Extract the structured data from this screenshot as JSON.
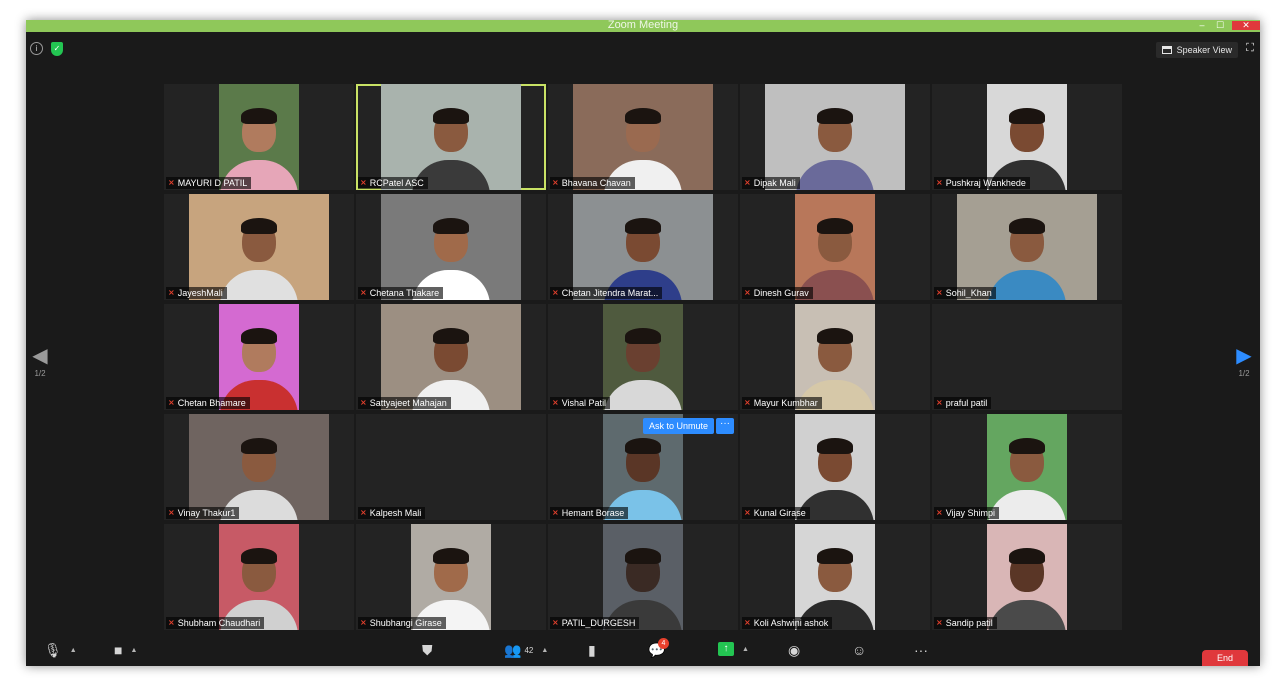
{
  "window": {
    "title": "Zoom Meeting",
    "controls": {
      "minimize": "–",
      "maximize": "☐",
      "close": "✕"
    }
  },
  "topbar": {
    "info_icon": "i",
    "shield_icon": "✓",
    "speaker_view_label": "Speaker View"
  },
  "navigation": {
    "left_arrow": "◀",
    "right_arrow": "▶",
    "page_left": "1/2",
    "page_right": "1/2"
  },
  "ask_to_unmute": {
    "label": "Ask to Unmute",
    "more": "···"
  },
  "participants": [
    {
      "name": "MAYURI D PATIL",
      "active": false,
      "video": true,
      "bg": "#5b7a4a",
      "skin": "#b07b5e",
      "shirt": "#e6a6b8"
    },
    {
      "name": "RCPatel ASC",
      "active": true,
      "video": true,
      "bg": "#a9b3ad",
      "skin": "#8a5a3f",
      "shirt": "#3a3a3a",
      "wide": true
    },
    {
      "name": "Bhavana Chavan",
      "active": false,
      "video": true,
      "bg": "#8a6b5a",
      "skin": "#9a6a50",
      "shirt": "#f0f0f0",
      "wide": true
    },
    {
      "name": "Dipak Mali",
      "active": false,
      "video": true,
      "bg": "#bfbfbf",
      "skin": "#8a5a3f",
      "shirt": "#6a6a9a",
      "wide": true
    },
    {
      "name": "Pushkraj Wankhede",
      "active": false,
      "video": true,
      "bg": "#d8d8d8",
      "skin": "#7a4a32",
      "shirt": "#303030"
    },
    {
      "name": "JayeshMali",
      "active": false,
      "video": true,
      "bg": "#c7a47e",
      "skin": "#8a5a3f",
      "shirt": "#e0e0e0",
      "wide": true
    },
    {
      "name": "Chetana Thakare",
      "active": false,
      "video": true,
      "bg": "#7a7a7a",
      "skin": "#a06a4a",
      "shirt": "#ffffff",
      "wide": true
    },
    {
      "name": "Chetan Jitendra Marat...",
      "active": false,
      "video": true,
      "bg": "#8c9092",
      "skin": "#7a4a32",
      "shirt": "#2e3e8a",
      "wide": true
    },
    {
      "name": "Dinesh Gurav",
      "active": false,
      "video": true,
      "bg": "#b8775a",
      "skin": "#8a5a3f",
      "shirt": "#8a5050"
    },
    {
      "name": "Sohil_Khan",
      "active": false,
      "video": true,
      "bg": "#a59f93",
      "skin": "#8a5a3f",
      "shirt": "#3a8ac2",
      "wide": true
    },
    {
      "name": "Chetan Bhamare",
      "active": false,
      "video": true,
      "bg": "#d46ad1",
      "skin": "#b07b5e",
      "shirt": "#c93030"
    },
    {
      "name": "Sattyajeet Mahajan",
      "active": false,
      "video": true,
      "bg": "#9c8f82",
      "skin": "#7a4a32",
      "shirt": "#f0f0f0",
      "wide": true
    },
    {
      "name": "Vishal Patil",
      "active": false,
      "video": true,
      "bg": "#4f5a3e",
      "skin": "#6a4030",
      "shirt": "#d8d8d8"
    },
    {
      "name": "Mayur Kumbhar",
      "active": false,
      "video": true,
      "bg": "#c8bfb4",
      "skin": "#8a5a3f",
      "shirt": "#d6c8a8"
    },
    {
      "name": "praful patil",
      "active": false,
      "video": false
    },
    {
      "name": "Vinay Thakur1",
      "active": false,
      "video": true,
      "bg": "#6f6460",
      "skin": "#8a5a3f",
      "shirt": "#dcdcdc",
      "wide": true
    },
    {
      "name": "Kalpesh Mali",
      "active": false,
      "video": false
    },
    {
      "name": "Hemant Borase",
      "active": false,
      "video": true,
      "bg": "#5e6a6e",
      "skin": "#5a3626",
      "shirt": "#7ac2e8"
    },
    {
      "name": "Kunal Girase",
      "active": false,
      "video": true,
      "bg": "#d0d0d0",
      "skin": "#7a4a32",
      "shirt": "#303030"
    },
    {
      "name": "Vijay Shimpi",
      "active": false,
      "video": true,
      "bg": "#64a660",
      "skin": "#8a5a3f",
      "shirt": "#ececec"
    },
    {
      "name": "Shubham Chaudhari",
      "active": false,
      "video": true,
      "bg": "#c75a66",
      "skin": "#8a5a3f",
      "shirt": "#d0d0d0"
    },
    {
      "name": "Shubhangi Girase",
      "active": false,
      "video": true,
      "bg": "#b0aba4",
      "skin": "#a06a4a",
      "shirt": "#f4f4f4"
    },
    {
      "name": "PATIL_DURGESH",
      "active": false,
      "video": true,
      "bg": "#5a5f66",
      "skin": "#3a2a24",
      "shirt": "#3a3a3a"
    },
    {
      "name": "Koli Ashwini ashok",
      "active": false,
      "video": true,
      "bg": "#d6d6d6",
      "skin": "#8a5a3f",
      "shirt": "#2a2a2a"
    },
    {
      "name": "Sandip patil",
      "active": false,
      "video": true,
      "bg": "#d9b6b6",
      "skin": "#5a3626",
      "shirt": "#4a4a4a"
    }
  ],
  "toolbar": {
    "participants_count": "42",
    "chat_badge": "4",
    "end_label": "End"
  },
  "colors": {
    "accent": "#2d8cff",
    "active_border": "#c9e265",
    "mute": "#e8412d",
    "share": "#23c552",
    "end": "#e0383c"
  }
}
